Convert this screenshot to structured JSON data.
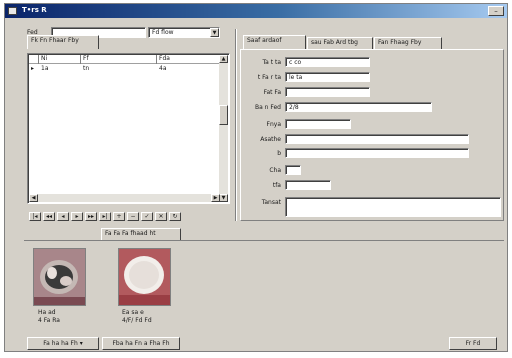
{
  "window": {
    "title": "T•rs R",
    "close_glyph": "–"
  },
  "search": {
    "label": "Fed",
    "value": "",
    "filter_value": "Fd flow",
    "filter_arrow": "▼"
  },
  "list": {
    "columns": [
      "Ni",
      "Ff",
      "Fda"
    ],
    "rows": [
      {
        "marker": "▸",
        "cells": [
          "1a",
          "tn",
          "4a"
        ]
      }
    ]
  },
  "nav_buttons": [
    "|◂",
    "◂◂",
    "◂",
    "▸",
    "▸▸",
    "▸|",
    "+",
    "−",
    "✓",
    "✕",
    "↻"
  ],
  "detail_tabs": [
    {
      "label": "Saaf ardaof"
    },
    {
      "label": "sau Fab Ard tbg"
    },
    {
      "label": "Fan Fhaag Fby"
    }
  ],
  "form": {
    "fields": [
      {
        "label": "Ta t ta",
        "value": "c co"
      },
      {
        "label": "t Fa r ta",
        "value": "le ta"
      },
      {
        "label": "Fat Fa",
        "value": ""
      },
      {
        "label": "Ba n Fed",
        "value": "2/8"
      },
      {
        "label": "Fnya",
        "value": ""
      },
      {
        "label": "Asathe",
        "value": ""
      },
      {
        "label": "b",
        "value": ""
      },
      {
        "label": "Cha",
        "value": ""
      },
      {
        "label": "tfa",
        "value": ""
      },
      {
        "label": "Tansat",
        "value": ""
      }
    ]
  },
  "image_tabs": [
    {
      "label": "Fk Fn Fhaar Fby"
    },
    {
      "label": "Fa Fa Fa fhaad ht"
    }
  ],
  "images": [
    {
      "caption_line1": "Ha ad",
      "caption_line2": "4 Fa Ra"
    },
    {
      "caption_line1": "Ea sa e",
      "caption_line2": "4/F/ Fd Fd"
    }
  ],
  "bottom_buttons": {
    "left1": "Fa ha ha Fh ▾",
    "left2": "Fba ha Fn a Fha Fh",
    "right": "Fr Fd"
  },
  "colors": {
    "chrome": "#d4d0c8",
    "title_start": "#0a246a",
    "title_end": "#a6caf0"
  }
}
